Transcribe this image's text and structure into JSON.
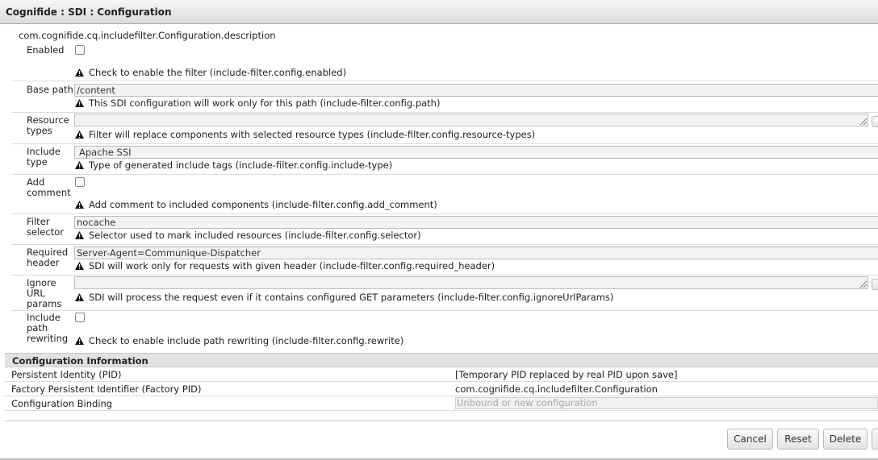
{
  "window": {
    "title": "Cognifide : SDI : Configuration"
  },
  "description": "com.cognifide.cq.includefilter.Configuration.description",
  "fields": [
    {
      "label": "Enabled",
      "type": "checkbox",
      "checked": false,
      "hint": "Check to enable the filter (include-filter.config.enabled)"
    },
    {
      "label": "Base path",
      "type": "text",
      "value": "/content",
      "hint": "This SDI configuration will work only for this path (include-filter.config.path)"
    },
    {
      "label": "Resource types",
      "type": "textarea",
      "value": "",
      "hint": "Filter will replace components with selected resource types (include-filter.config.resource-types)"
    },
    {
      "label": "Include type",
      "type": "select",
      "value": "Apache SSI",
      "hint": "Type of generated include tags (include-filter.config.include-type)"
    },
    {
      "label": "Add comment",
      "type": "checkbox",
      "checked": false,
      "hint": "Add comment to included components (include-filter.config.add_comment)"
    },
    {
      "label": "Filter selector",
      "type": "text",
      "value": "nocache",
      "hint": "Selector used to mark included resources (include-filter.config.selector)"
    },
    {
      "label": "Required header",
      "type": "text",
      "value": "Server-Agent=Communique-Dispatcher",
      "hint": "SDI will work only for requests with given header (include-filter.config.required_header)"
    },
    {
      "label": "Ignore URL params",
      "type": "textarea",
      "value": "",
      "hint": "SDI will process the request even if it contains configured GET parameters (include-filter.config.ignoreUrlParams)"
    },
    {
      "label": "Include path rewriting",
      "type": "checkbox",
      "checked": false,
      "hint": "Check to enable include path rewriting (include-filter.config.rewrite)"
    }
  ],
  "config_info": {
    "title": "Configuration Information",
    "rows": [
      {
        "key": "Persistent Identity (PID)",
        "value": "[Temporary PID replaced by real PID upon save]"
      },
      {
        "key": "Factory Persistent Identifier (Factory PID)",
        "value": "com.cognifide.cq.includefilter.Configuration"
      },
      {
        "key": "Configuration Binding",
        "value": "Unbound or new configuration"
      }
    ]
  },
  "buttons": {
    "cancel": "Cancel",
    "reset": "Reset",
    "delete": "Delete"
  },
  "icons": {
    "hint_icon": "warning-icon",
    "resize_grip": "resize-grip-icon"
  }
}
